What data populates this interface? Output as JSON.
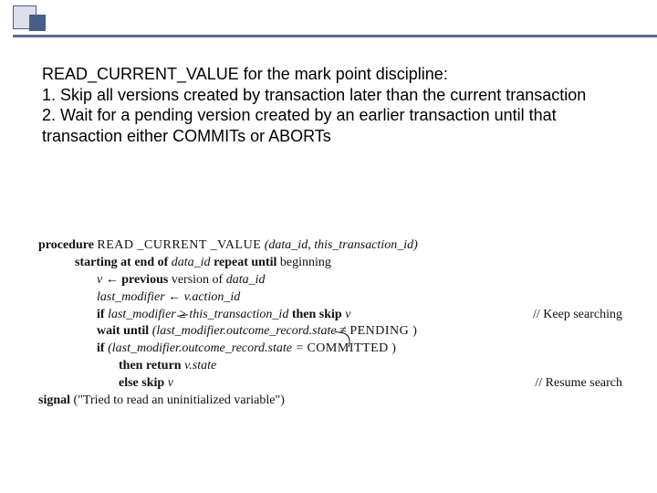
{
  "body": {
    "line1": "READ_CURRENT_VALUE for the mark point discipline:",
    "line2": "1. Skip all versions created by transaction later than the current transaction",
    "line3": "2. Wait for a pending version created by an earlier transaction until that transaction either COMMITs or ABORTs"
  },
  "code": {
    "l1_kw1": "procedure",
    "l1_name": "READ _CURRENT _VALUE",
    "l1_args": " (data_id, this_transaction_id)",
    "l2_kw1": "starting at end of",
    "l2_mid": " data_id ",
    "l2_kw2": "repeat until",
    "l2_end": " beginning",
    "l3_pre": "v ← ",
    "l3_kw": "previous",
    "l3_post": " version of ",
    "l3_var": "data_id",
    "l4": "last_modifier ← v.action_id",
    "l5_kw": "if",
    "l5_a": " last_modifier ",
    "l5_op": "≥",
    "l5_b": " this_transaction_id ",
    "l5_kw2": "then skip",
    "l5_c": " v",
    "l5_cmt": "// Keep searching",
    "l6_kw": "wait until",
    "l6_body": " (last_modifier.outcome_record.state ",
    "l6_op": "≠",
    "l6_end": " PENDING )",
    "l7_kw": "if",
    "l7_body": " (last_modifier.outcome_record.state = ",
    "l7_c": "COMMITTED",
    "l7_close": " )",
    "l8_kw": "then return",
    "l8_body": " v.state",
    "l9_kw": "else skip",
    "l9_body": " v",
    "l9_cmt": "// Resume search",
    "l10_kw": "signal",
    "l10_body": " (\"Tried to read an uninitialized variable\")"
  }
}
